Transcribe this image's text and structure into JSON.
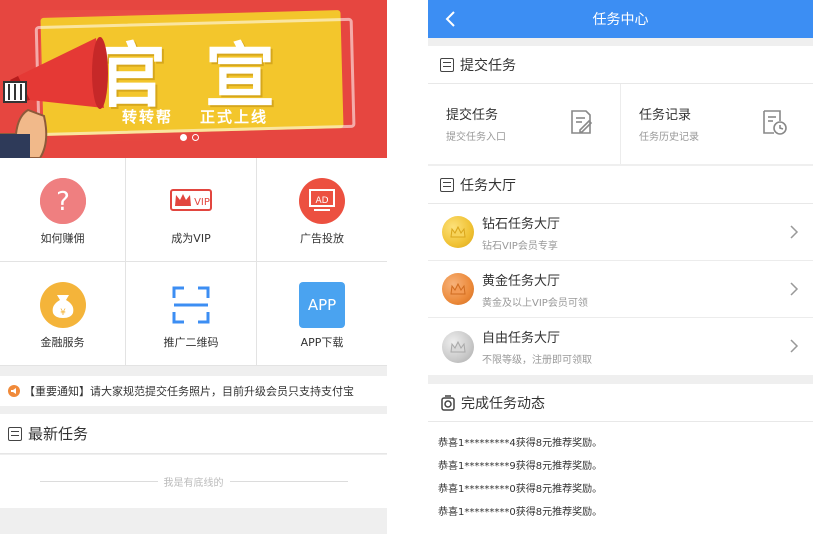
{
  "left": {
    "banner": {
      "char1": "官",
      "char2": "宣",
      "sub1": "转转帮",
      "sub2": "正式上线"
    },
    "menu": [
      {
        "label": "如何赚佣",
        "icon": "question-icon",
        "color": "#ef7a7a"
      },
      {
        "label": "成为VIP",
        "icon": "vip-crown-icon",
        "color": "#e2463f"
      },
      {
        "label": "广告投放",
        "icon": "ad-icon",
        "color": "#ec5040"
      },
      {
        "label": "金融服务",
        "icon": "money-bag-icon",
        "color": "#f4b43a"
      },
      {
        "label": "推广二维码",
        "icon": "qr-scan-icon",
        "color": "#3c8ef3"
      },
      {
        "label": "APP下载",
        "icon": "app-icon",
        "color": "#4aa3f0",
        "icon_text": "APP"
      }
    ],
    "notice": "【重要通知】请大家规范提交任务照片，目前升级会员只支持支付宝",
    "latest_title": "最新任务",
    "end_text": "我是有底线的"
  },
  "right": {
    "header_title": "任务中心",
    "submit_section": {
      "title": "提交任务",
      "items": [
        {
          "title": "提交任务",
          "sub": "提交任务入口",
          "icon": "edit-doc-icon"
        },
        {
          "title": "任务记录",
          "sub": "任务历史记录",
          "icon": "history-doc-icon"
        }
      ]
    },
    "hall_section": {
      "title": "任务大厅",
      "items": [
        {
          "title": "钻石任务大厅",
          "sub": "钻石VIP会员专享",
          "color": "#f0c234"
        },
        {
          "title": "黄金任务大厅",
          "sub": "黄金及以上VIP会员可领",
          "color": "#ec8a3a"
        },
        {
          "title": "自由任务大厅",
          "sub": "不限等级，注册即可领取",
          "color": "#c9c9c9"
        }
      ]
    },
    "feed_section": {
      "title": "完成任务动态",
      "items": [
        "恭喜1*********4获得8元推荐奖励。",
        "恭喜1*********9获得8元推荐奖励。",
        "恭喜1*********0获得8元推荐奖励。",
        "恭喜1*********0获得8元推荐奖励。"
      ]
    }
  }
}
